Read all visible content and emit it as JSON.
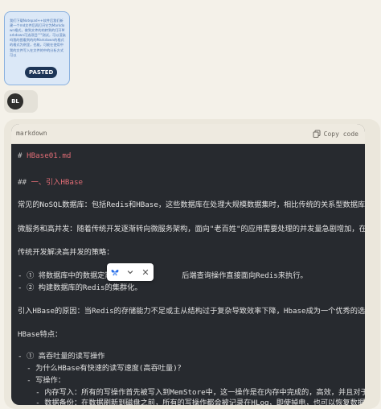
{
  "pasted": {
    "preview_text": "我们下载Notepad++软件后我们新建一个md文件后再打开它为Markdown格式，做到文件的的转到的打开Markdown可选项目\"\"\"测试，可以渲染吗我的图看到的的Markdown的格式的格式为例里，也能，可能在使用中我的文件写入在文件的中的分析方式可以",
    "badge": "PASTED"
  },
  "user": {
    "avatar_initials": "BL"
  },
  "code_block": {
    "language": "markdown",
    "copy_label": "Copy code",
    "lines": [
      {
        "segments": [
          {
            "text": "# ",
            "style": "mark"
          },
          {
            "text": "HBase01.md",
            "style": "heading"
          }
        ]
      },
      {
        "segments": [
          {
            "text": "## ",
            "style": "mark"
          },
          {
            "text": "一、引入HBase",
            "style": "heading"
          }
        ]
      },
      {
        "segments": [
          {
            "text": "常见的NoSQL数据库：包括Redis和HBase，这些数据库在处理大规模数据集时，相比传统的关系型数据库，提供",
            "style": "text"
          }
        ]
      },
      {
        "segments": [
          {
            "text": "微服务和高并发：随着传统开发逐渐转向微服务架构，面向\"老百姓\"的应用需要处理的并发量急剧增加，在这种",
            "style": "text"
          }
        ]
      },
      {
        "segments": [
          {
            "text": "传统开发解决高并发的策略：",
            "style": "text"
          }
        ]
      },
      {
        "segments": [
          {
            "text": "- ① 将数据库中的数据定期存",
            "style": "text"
          },
          {
            "text": "              后端查询操作直接面向Redis来执行。",
            "style": "text"
          }
        ]
      },
      {
        "segments": [
          {
            "text": "- ② 构建数据库的Redis的集群化。",
            "style": "text"
          }
        ]
      },
      {
        "segments": [
          {
            "text": "引入HBase的原因：当Redis的存储能力不足或主从结构过于复杂导致效率下降，Hbase成为一个优秀的选择。HB",
            "style": "text"
          }
        ]
      },
      {
        "segments": [
          {
            "text": "HBase特点：",
            "style": "text"
          }
        ]
      },
      {
        "segments": [
          {
            "text": "- ① 高吞吐量的读写操作",
            "style": "text"
          }
        ]
      },
      {
        "segments": [
          {
            "text": "  - 为什么HBase有快速的读写速度(高吞吐量)？",
            "style": "text"
          }
        ]
      },
      {
        "segments": [
          {
            "text": "  - 写操作：",
            "style": "text"
          }
        ]
      },
      {
        "segments": [
          {
            "text": "    - 内存写入：所有的写操作首先被写入到MemStore中，这一操作是在内存中完成的，高效，并且对于HB",
            "style": "text"
          }
        ]
      },
      {
        "segments": [
          {
            "text": "    - 数据备份：在数据刷新到磁盘之前，所有的写操作都会被记录在HLog，即使掉电，也可以恢复数据。",
            "style": "text"
          }
        ]
      }
    ]
  }
}
